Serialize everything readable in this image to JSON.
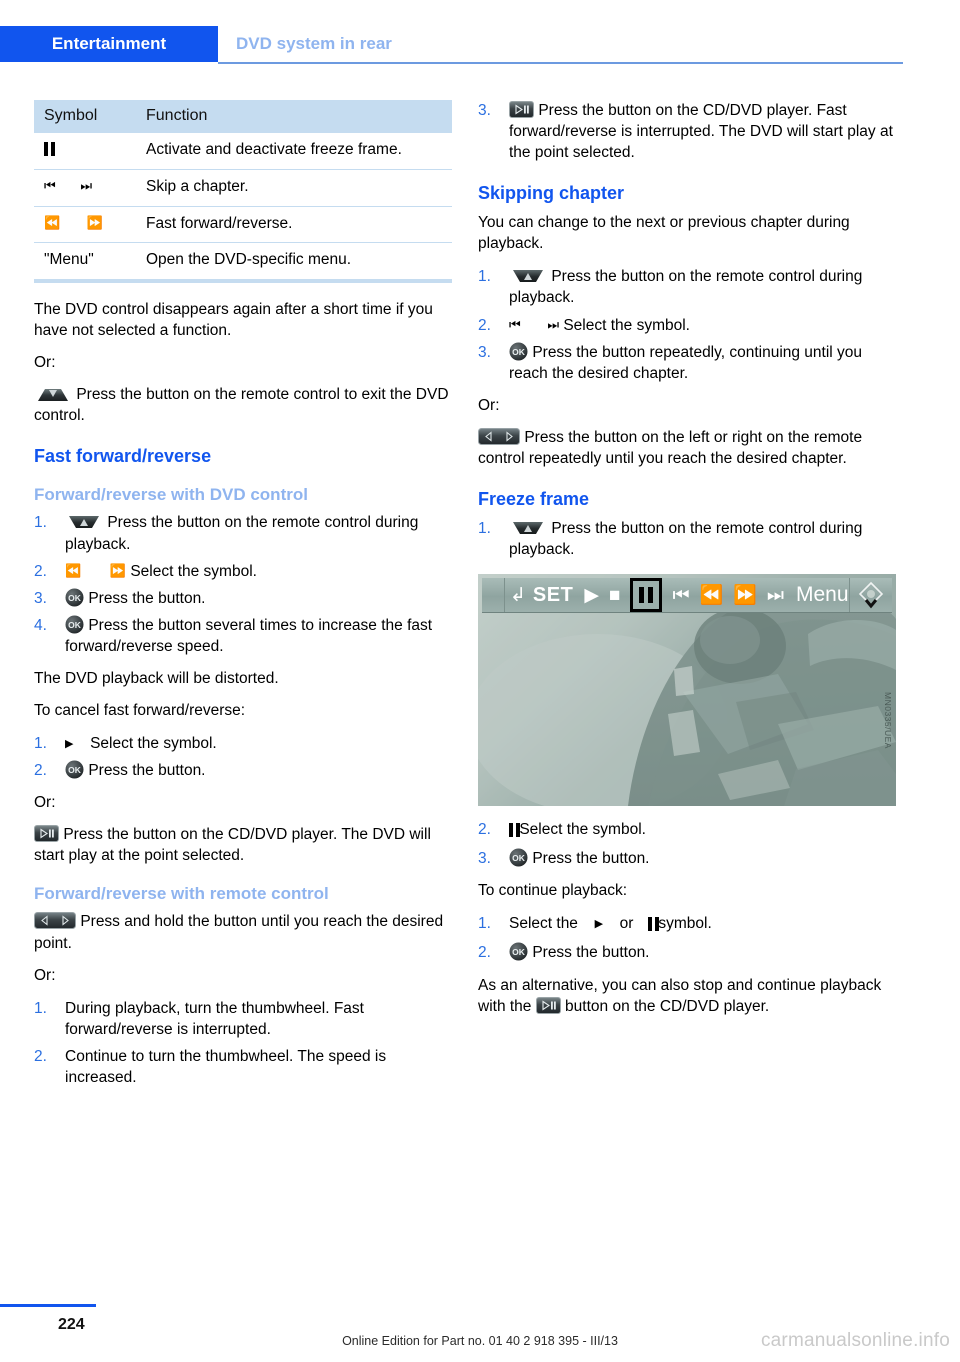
{
  "header": {
    "tab": "Entertainment",
    "subtitle": "DVD system in rear"
  },
  "table": {
    "headers": [
      "Symbol",
      "Function"
    ],
    "rows": [
      {
        "symbol_icons": [
          "pause"
        ],
        "function": "Activate and deactivate freeze frame."
      },
      {
        "symbol_icons": [
          "skip-prev",
          "skip-next"
        ],
        "function": "Skip a chapter."
      },
      {
        "symbol_icons": [
          "rewind",
          "fast-forward"
        ],
        "function": "Fast forward/reverse."
      },
      {
        "symbol_text": "\"Menu\"",
        "function": "Open the DVD-specific menu."
      }
    ]
  },
  "left": {
    "p1": "The DVD control disappears again after a short time if you have not selected a function.",
    "or1": "Or:",
    "p2": "Press the button on the remote control to exit the DVD control.",
    "h_fast_forward": "Fast forward/reverse",
    "h_fwd_dvd_control": "Forward/reverse with DVD control",
    "steps1": [
      {
        "n": "1.",
        "text": "Press the button on the remote control during playback."
      },
      {
        "n": "2.",
        "text": "Select the symbol."
      },
      {
        "n": "3.",
        "text": "Press the button."
      },
      {
        "n": "4.",
        "text": "Press the button several times to increase the fast forward/reverse speed."
      }
    ],
    "p3": "The DVD playback will be distorted.",
    "p4": "To cancel fast forward/reverse:",
    "steps2": [
      {
        "n": "1.",
        "text": "Select the symbol."
      },
      {
        "n": "2.",
        "text": "Press the button."
      }
    ],
    "or2": "Or:",
    "p5": "Press the button on the CD/DVD player. The DVD will start play at the point selected.",
    "h_fwd_remote": "Forward/reverse with remote control",
    "p6": "Press and hold the button until you reach the desired point.",
    "or3": "Or:",
    "steps3": [
      {
        "n": "1.",
        "text": "During playback, turn the thumbwheel. Fast forward/reverse is interrupted."
      },
      {
        "n": "2.",
        "text": "Continue to turn the thumbwheel. The speed is increased."
      }
    ]
  },
  "right": {
    "step3": {
      "n": "3.",
      "text": "Press the button on the CD/DVD player. Fast forward/reverse is interrupted. The DVD will start play at the point selected."
    },
    "h_skipping": "Skipping chapter",
    "p1": "You can change to the next or previous chapter during playback.",
    "steps1": [
      {
        "n": "1.",
        "text": "Press the button on the remote control during playback."
      },
      {
        "n": "2.",
        "text": "Select the symbol."
      },
      {
        "n": "3.",
        "text": "Press the button repeatedly, continuing until you reach the desired chapter."
      }
    ],
    "or1": "Or:",
    "p2": "Press the button on the left or right on the remote control repeatedly until you reach the desired chapter.",
    "h_freeze": "Freeze frame",
    "steps2": [
      {
        "n": "1.",
        "text": "Press the button on the remote control during playback."
      }
    ],
    "steps3": [
      {
        "n": "2.",
        "text": "Select the symbol."
      },
      {
        "n": "3.",
        "text": "Press the button."
      }
    ],
    "p3": "To continue playback:",
    "step_continue_a_pre": "Select the",
    "step_continue_a_mid": "or",
    "step_continue_a_post": "symbol.",
    "step_continue_n1": "1.",
    "step_continue_n2": "2.",
    "step_continue_b": "Press the button.",
    "p4_pre": "As an alternative, you can also stop and continue playback with the",
    "p4_post": "button on the CD/DVD player."
  },
  "screenshot": {
    "set_label": "SET",
    "menu_label": "Menu",
    "icons": [
      "back-arrow",
      "play",
      "stop",
      "pause-selected",
      "skip-prev",
      "rewind",
      "fast-forward",
      "skip-next"
    ],
    "image_code": "MN0335/UEA"
  },
  "footer": {
    "page": "224",
    "text": "Online Edition for Part no. 01 40 2 918 395 - III/13",
    "watermark": "carmanualsonline.info"
  },
  "colors": {
    "accent_blue": "#1155ee",
    "light_blue": "#8fb4ef",
    "table_header": "#c5dcf0",
    "step_number": "#2b6fe0"
  }
}
